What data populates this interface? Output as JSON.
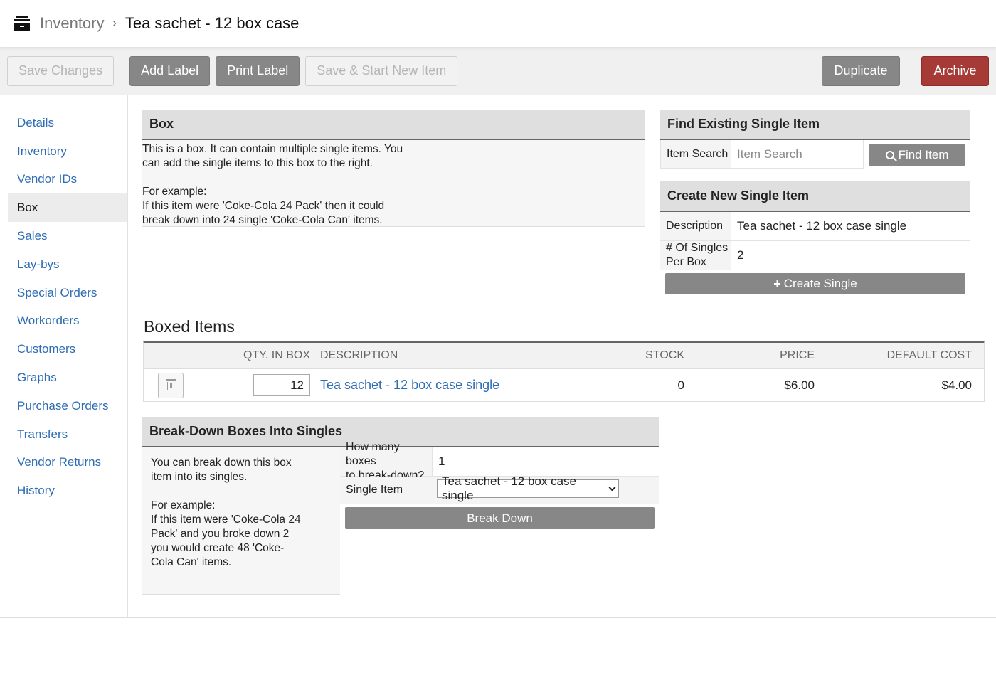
{
  "breadcrumb": {
    "icon": "archive-icon",
    "parent": "Inventory",
    "separator": "›",
    "current": "Tea sachet - 12 box case"
  },
  "toolbar": {
    "save_changes": "Save Changes",
    "add_label": "Add Label",
    "print_label": "Print Label",
    "save_start_new": "Save & Start New Item",
    "duplicate": "Duplicate",
    "archive": "Archive"
  },
  "colors": {
    "link": "#2e6db4",
    "gray_button": "#878787",
    "archive_button": "#a63a36"
  },
  "sidebar": {
    "items": [
      {
        "label": "Details",
        "active": false
      },
      {
        "label": "Inventory",
        "active": false
      },
      {
        "label": "Vendor IDs",
        "active": false
      },
      {
        "label": "Box",
        "active": true
      },
      {
        "label": "Sales",
        "active": false
      },
      {
        "label": "Lay-bys",
        "active": false
      },
      {
        "label": "Special Orders",
        "active": false
      },
      {
        "label": "Workorders",
        "active": false
      },
      {
        "label": "Customers",
        "active": false
      },
      {
        "label": "Graphs",
        "active": false
      },
      {
        "label": "Purchase Orders",
        "active": false
      },
      {
        "label": "Transfers",
        "active": false
      },
      {
        "label": "Vendor Returns",
        "active": false
      },
      {
        "label": "History",
        "active": false
      }
    ]
  },
  "box_panel": {
    "title": "Box",
    "line1": "This is a box. It can contain multiple single items. You",
    "line2": "can add the single items to this box to the right.",
    "line3": "For example:",
    "line4": "If this item were 'Coke-Cola 24 Pack' then it could",
    "line5": "break down into 24 single 'Coke-Cola Can' items."
  },
  "find_panel": {
    "title": "Find Existing Single Item",
    "search_label": "Item Search",
    "search_placeholder": "Item Search",
    "search_value": "",
    "find_button": "Find Item"
  },
  "create_panel": {
    "title": "Create New Single Item",
    "description_label": "Description",
    "description_value": "Tea sachet - 12 box case single",
    "singles_label_1": "# Of Singles",
    "singles_label_2": "Per Box",
    "singles_value": "2",
    "create_button": "Create Single"
  },
  "boxed_items": {
    "title": "Boxed Items",
    "columns": {
      "qty": "QTY. IN BOX",
      "description": "DESCRIPTION",
      "stock": "STOCK",
      "price": "PRICE",
      "default_cost": "DEFAULT COST"
    },
    "rows": [
      {
        "qty": "12",
        "description": "Tea sachet - 12 box case single",
        "stock": "0",
        "price": "$6.00",
        "default_cost": "$4.00"
      }
    ]
  },
  "breakdown_panel": {
    "title": "Break-Down Boxes Into Singles",
    "help_line1": "You can break down this box",
    "help_line2": "item into its singles.",
    "help_line3": "For example:",
    "help_line4": "If this item were 'Coke-Cola 24",
    "help_line5": "Pack' and you broke down 2",
    "help_line6": "you would create 48 'Coke-",
    "help_line7": "Cola Can' items.",
    "boxes_label_1": "How many boxes",
    "boxes_label_2": "to break-down?",
    "boxes_value": "1",
    "single_item_label": "Single Item",
    "single_item_selected": "Tea sachet - 12 box case single",
    "break_button": "Break Down"
  }
}
